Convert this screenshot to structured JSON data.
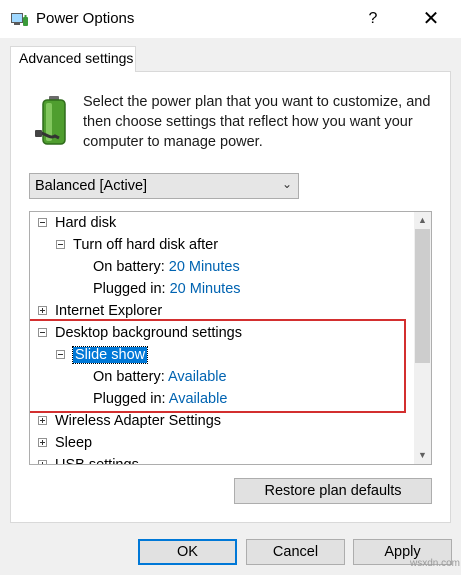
{
  "window": {
    "title": "Power Options",
    "help_label": "?",
    "close_label": "✕"
  },
  "tab": {
    "label": "Advanced settings"
  },
  "description": "Select the power plan that you want to customize, and then choose settings that reflect how you want your computer to manage power.",
  "plan_select": {
    "value": "Balanced [Active]"
  },
  "tree": [
    {
      "label": "Hard disk",
      "level": 0,
      "expander": "minus"
    },
    {
      "label": "Turn off hard disk after",
      "level": 1,
      "expander": "minus"
    },
    {
      "label": "On battery:",
      "value": "20 Minutes",
      "level": 2
    },
    {
      "label": "Plugged in:",
      "value": "20 Minutes",
      "level": 2
    },
    {
      "label": "Internet Explorer",
      "level": 0,
      "expander": "plus"
    },
    {
      "label": "Desktop background settings",
      "level": 0,
      "expander": "minus"
    },
    {
      "label": "Slide show",
      "level": 1,
      "expander": "minus",
      "selected": true
    },
    {
      "label": "On battery:",
      "value": "Available",
      "level": 2
    },
    {
      "label": "Plugged in:",
      "value": "Available",
      "level": 2
    },
    {
      "label": "Wireless Adapter Settings",
      "level": 0,
      "expander": "plus"
    },
    {
      "label": "Sleep",
      "level": 0,
      "expander": "plus"
    },
    {
      "label": "USB settings",
      "level": 0,
      "expander": "plus"
    }
  ],
  "buttons": {
    "restore": "Restore plan defaults",
    "ok": "OK",
    "cancel": "Cancel",
    "apply": "Apply"
  },
  "watermark": "wsxdn.com",
  "colors": {
    "link": "#0063b1",
    "selection": "#0078d7",
    "highlight_box": "#d32f2f"
  }
}
